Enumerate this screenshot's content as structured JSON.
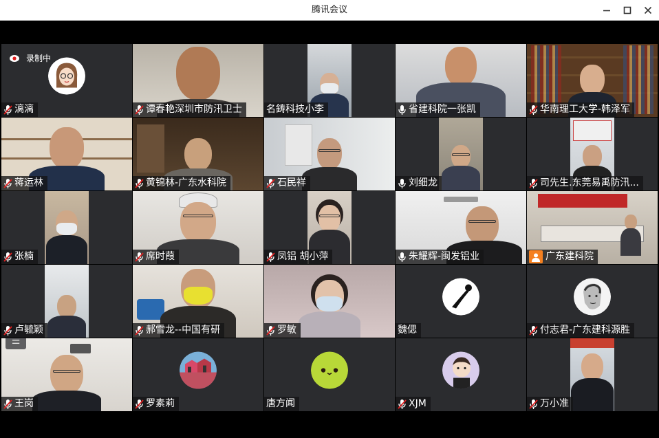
{
  "window": {
    "title": "腾讯会议",
    "minimize_icon": "minimize-icon",
    "maximize_icon": "maximize-icon",
    "close_icon": "close-icon"
  },
  "recording": {
    "label": "录制中",
    "icon": "record-icon"
  },
  "colors": {
    "titlebar_bg": "#ffffff",
    "stage_bg": "#000000",
    "tile_bg": "#2b2c2f",
    "active_speaker": "#20c060",
    "mic_muted": "#e02020",
    "screenshare_badge": "#f58020"
  },
  "participants": [
    {
      "name": "漓漓",
      "mic": "muted",
      "video": false,
      "avatar": "cartoon-girl"
    },
    {
      "name": "谭春艳深圳市防汛卫士",
      "mic": "muted",
      "video": true
    },
    {
      "name": "名鋳科技小李",
      "mic": "none",
      "video": true
    },
    {
      "name": "省建科院一张凯",
      "mic": "on",
      "video": true,
      "active_speaker": true
    },
    {
      "name": "华南理工大学-韩泽军",
      "mic": "muted",
      "video": true
    },
    {
      "name": "蒋运林",
      "mic": "muted",
      "video": true
    },
    {
      "name": "黄锦林-广东水科院",
      "mic": "muted",
      "video": true
    },
    {
      "name": "石民祥",
      "mic": "muted",
      "video": true
    },
    {
      "name": "刘细龙",
      "mic": "on",
      "video": true
    },
    {
      "name": "司先生.东莞易禹防汛...",
      "mic": "muted",
      "video": true
    },
    {
      "name": "张楠",
      "mic": "muted",
      "video": true
    },
    {
      "name": "席时葭",
      "mic": "muted",
      "video": true
    },
    {
      "name": "凤铝 胡小萍",
      "mic": "muted",
      "video": true
    },
    {
      "name": "朱耀辉-闽发铝业",
      "mic": "on",
      "video": true
    },
    {
      "name": "广东建科院",
      "mic": "screenshare",
      "video": true
    },
    {
      "name": "卢毓颖",
      "mic": "muted",
      "video": true
    },
    {
      "name": "郝雪龙--中国有研",
      "mic": "muted",
      "video": true
    },
    {
      "name": "罗敏",
      "mic": "muted",
      "video": true
    },
    {
      "name": "魏偲",
      "mic": "none",
      "video": false,
      "avatar": "black-sketch"
    },
    {
      "name": "付志君-广东建科源胜",
      "mic": "muted",
      "video": false,
      "avatar": "sketch-portrait"
    },
    {
      "name": "王岗",
      "mic": "muted",
      "video": true
    },
    {
      "name": "罗素莉",
      "mic": "muted",
      "video": false,
      "avatar": "building-photo"
    },
    {
      "name": "唐方闻",
      "mic": "none",
      "video": false,
      "avatar": "green-face"
    },
    {
      "name": "XJM",
      "mic": "muted",
      "video": false,
      "avatar": "cartoon-baby"
    },
    {
      "name": "万小准",
      "mic": "muted",
      "video": true
    }
  ],
  "list_button": {
    "label": "☰",
    "icon": "participant-list-icon"
  }
}
